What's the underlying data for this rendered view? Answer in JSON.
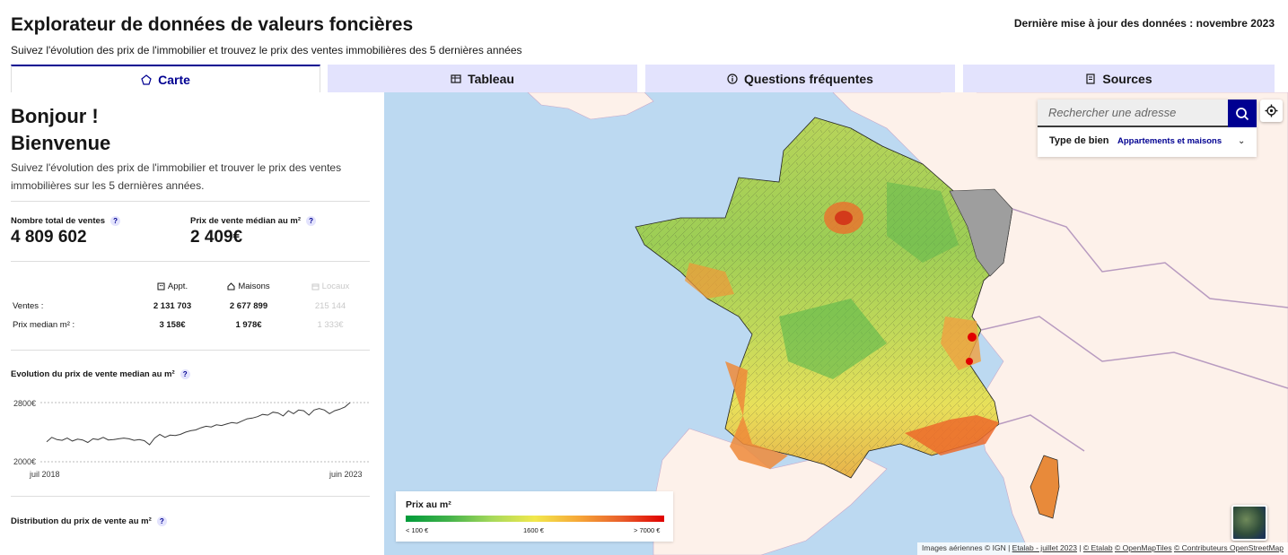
{
  "header": {
    "title": "Explorateur de données de valeurs foncières",
    "subtitle": "Suivez l'évolution des prix de l'immobilier et trouvez le prix des ventes immobilières des 5 dernières années",
    "last_update": "Dernière mise à jour des données : novembre 2023"
  },
  "tabs": [
    {
      "label": "Carte",
      "icon": "map-pin-icon",
      "active": true
    },
    {
      "label": "Tableau",
      "icon": "table-icon",
      "active": false
    },
    {
      "label": "Questions fréquentes",
      "icon": "info-icon",
      "active": false
    },
    {
      "label": "Sources",
      "icon": "document-icon",
      "active": false
    }
  ],
  "sidebar": {
    "greeting_1": "Bonjour !",
    "greeting_2": "Bienvenue",
    "intro": "Suivez l'évolution des prix de l'immobilier et trouver le prix des ventes immobilières sur les 5 dernières années.",
    "total_sales_label": "Nombre total de ventes",
    "total_sales_value": "4 809 602",
    "median_price_label": "Prix de vente médian au m²",
    "median_price_value": "2 409€",
    "help_glyph": "?",
    "table": {
      "columns": [
        "Appt.",
        "Maisons",
        "Locaux"
      ],
      "rows": [
        {
          "label": "Ventes :",
          "values": [
            "2 131 703",
            "2 677 899",
            "215 144"
          ]
        },
        {
          "label": "Prix median m² :",
          "values": [
            "3 158€",
            "1 978€",
            "1 333€"
          ]
        }
      ]
    },
    "evolution_title": "Evolution du prix de vente median au m²",
    "evolution_y_max": "2800€",
    "evolution_y_min": "2000€",
    "evolution_x_start": "juil 2018",
    "evolution_x_end": "juin 2023",
    "distribution_title": "Distribution du prix de vente au m²"
  },
  "evolution_chart": {
    "type": "line",
    "ylim": [
      2000,
      2800
    ],
    "values": [
      2270,
      2330,
      2300,
      2290,
      2320,
      2280,
      2305,
      2295,
      2260,
      2310,
      2300,
      2330,
      2295,
      2300,
      2310,
      2320,
      2310,
      2290,
      2300,
      2285,
      2230,
      2320,
      2370,
      2330,
      2360,
      2355,
      2370,
      2400,
      2420,
      2430,
      2460,
      2480,
      2470,
      2500,
      2490,
      2510,
      2530,
      2520,
      2550,
      2580,
      2590,
      2610,
      2640,
      2630,
      2670,
      2660,
      2620,
      2690,
      2650,
      2700,
      2690,
      2630,
      2700,
      2720,
      2700,
      2650,
      2690,
      2710,
      2740,
      2800
    ]
  },
  "map": {
    "search_placeholder": "Rechercher une adresse",
    "type_label": "Type de bien",
    "type_value": "Appartements et maisons",
    "legend_title": "Prix au m²",
    "legend_min": "< 100 €",
    "legend_mid": "1600 €",
    "legend_max": "> 7000 €",
    "attribution": {
      "text1": "Images aériennes © IGN | ",
      "link1": "Etalab - juillet 2023",
      "sep1": " | ",
      "link2": "© Etalab",
      "sep2": "  ",
      "link3": "© OpenMapTiles",
      "sep3": "  ",
      "link4": "© Contributeurs OpenStreetMap"
    }
  },
  "colors": {
    "primary": "#000091",
    "tab_inactive": "#e3e3fd",
    "sea": "#bcd9f1",
    "land": "#fdf1ea"
  }
}
